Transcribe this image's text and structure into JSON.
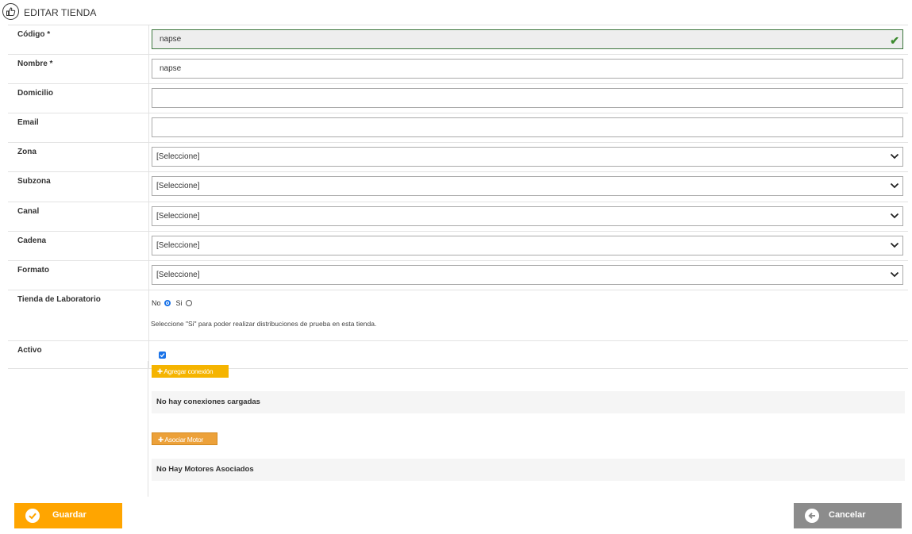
{
  "header": {
    "title": "EDITAR TIENDA"
  },
  "fields": {
    "codigo": {
      "label": "Código *",
      "value": "napse"
    },
    "nombre": {
      "label": "Nombre *",
      "value": "napse"
    },
    "domicilio": {
      "label": "Domicilio",
      "value": ""
    },
    "email": {
      "label": "Email",
      "value": ""
    },
    "zona": {
      "label": "Zona",
      "selected": "[Seleccione]"
    },
    "subzona": {
      "label": "Subzona",
      "selected": "[Seleccione]"
    },
    "canal": {
      "label": "Canal",
      "selected": "[Seleccione]"
    },
    "cadena": {
      "label": "Cadena",
      "selected": "[Seleccione]"
    },
    "formato": {
      "label": "Formato",
      "selected": "[Seleccione]"
    },
    "laboratorio": {
      "label": "Tienda de Laboratorio",
      "no_label": "No",
      "si_label": "Si",
      "selected": "No",
      "help": "Seleccione \"Si\" para poder realizar distribuciones de prueba en esta tienda."
    },
    "activo": {
      "label": "Activo",
      "checked": true
    }
  },
  "conexiones": {
    "add_label": "Agregar conexión",
    "empty_text": "No hay conexiones cargadas"
  },
  "motores": {
    "add_label": "Asociar Motor",
    "empty_text": "No Hay Motores Asociados"
  },
  "actions": {
    "save_label": "Guardar",
    "cancel_label": "Cancelar"
  },
  "colors": {
    "accent": "#ffa500",
    "valid": "#3c763d",
    "cancel": "#8c8c8c",
    "checkbox": "#1a73e8"
  },
  "icons": {
    "header": "thumbs-up-icon",
    "save": "check-circle-icon",
    "cancel": "arrow-left-circle-icon"
  }
}
